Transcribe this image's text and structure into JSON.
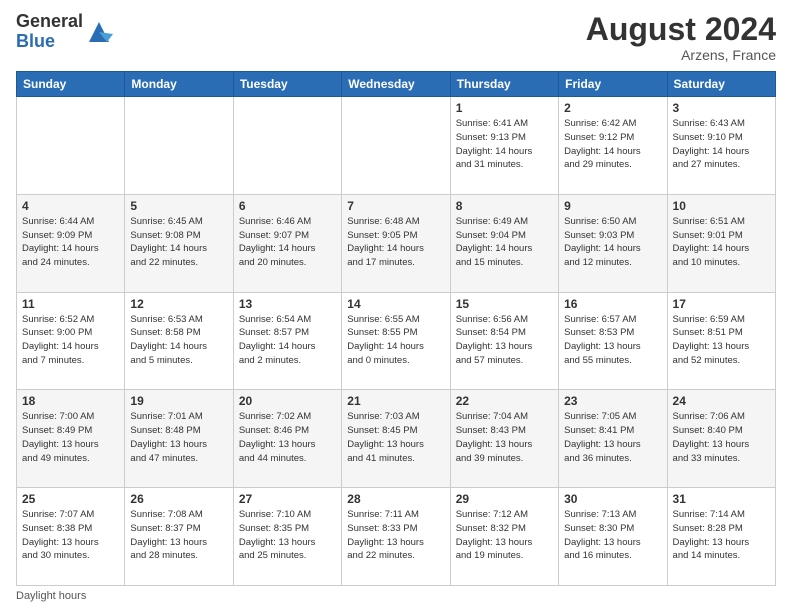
{
  "header": {
    "logo_general": "General",
    "logo_blue": "Blue",
    "month_year": "August 2024",
    "location": "Arzens, France"
  },
  "days_of_week": [
    "Sunday",
    "Monday",
    "Tuesday",
    "Wednesday",
    "Thursday",
    "Friday",
    "Saturday"
  ],
  "footer": {
    "daylight_hours_label": "Daylight hours"
  },
  "weeks": [
    [
      {
        "day": "",
        "info": ""
      },
      {
        "day": "",
        "info": ""
      },
      {
        "day": "",
        "info": ""
      },
      {
        "day": "",
        "info": ""
      },
      {
        "day": "1",
        "info": "Sunrise: 6:41 AM\nSunset: 9:13 PM\nDaylight: 14 hours\nand 31 minutes."
      },
      {
        "day": "2",
        "info": "Sunrise: 6:42 AM\nSunset: 9:12 PM\nDaylight: 14 hours\nand 29 minutes."
      },
      {
        "day": "3",
        "info": "Sunrise: 6:43 AM\nSunset: 9:10 PM\nDaylight: 14 hours\nand 27 minutes."
      }
    ],
    [
      {
        "day": "4",
        "info": "Sunrise: 6:44 AM\nSunset: 9:09 PM\nDaylight: 14 hours\nand 24 minutes."
      },
      {
        "day": "5",
        "info": "Sunrise: 6:45 AM\nSunset: 9:08 PM\nDaylight: 14 hours\nand 22 minutes."
      },
      {
        "day": "6",
        "info": "Sunrise: 6:46 AM\nSunset: 9:07 PM\nDaylight: 14 hours\nand 20 minutes."
      },
      {
        "day": "7",
        "info": "Sunrise: 6:48 AM\nSunset: 9:05 PM\nDaylight: 14 hours\nand 17 minutes."
      },
      {
        "day": "8",
        "info": "Sunrise: 6:49 AM\nSunset: 9:04 PM\nDaylight: 14 hours\nand 15 minutes."
      },
      {
        "day": "9",
        "info": "Sunrise: 6:50 AM\nSunset: 9:03 PM\nDaylight: 14 hours\nand 12 minutes."
      },
      {
        "day": "10",
        "info": "Sunrise: 6:51 AM\nSunset: 9:01 PM\nDaylight: 14 hours\nand 10 minutes."
      }
    ],
    [
      {
        "day": "11",
        "info": "Sunrise: 6:52 AM\nSunset: 9:00 PM\nDaylight: 14 hours\nand 7 minutes."
      },
      {
        "day": "12",
        "info": "Sunrise: 6:53 AM\nSunset: 8:58 PM\nDaylight: 14 hours\nand 5 minutes."
      },
      {
        "day": "13",
        "info": "Sunrise: 6:54 AM\nSunset: 8:57 PM\nDaylight: 14 hours\nand 2 minutes."
      },
      {
        "day": "14",
        "info": "Sunrise: 6:55 AM\nSunset: 8:55 PM\nDaylight: 14 hours\nand 0 minutes."
      },
      {
        "day": "15",
        "info": "Sunrise: 6:56 AM\nSunset: 8:54 PM\nDaylight: 13 hours\nand 57 minutes."
      },
      {
        "day": "16",
        "info": "Sunrise: 6:57 AM\nSunset: 8:53 PM\nDaylight: 13 hours\nand 55 minutes."
      },
      {
        "day": "17",
        "info": "Sunrise: 6:59 AM\nSunset: 8:51 PM\nDaylight: 13 hours\nand 52 minutes."
      }
    ],
    [
      {
        "day": "18",
        "info": "Sunrise: 7:00 AM\nSunset: 8:49 PM\nDaylight: 13 hours\nand 49 minutes."
      },
      {
        "day": "19",
        "info": "Sunrise: 7:01 AM\nSunset: 8:48 PM\nDaylight: 13 hours\nand 47 minutes."
      },
      {
        "day": "20",
        "info": "Sunrise: 7:02 AM\nSunset: 8:46 PM\nDaylight: 13 hours\nand 44 minutes."
      },
      {
        "day": "21",
        "info": "Sunrise: 7:03 AM\nSunset: 8:45 PM\nDaylight: 13 hours\nand 41 minutes."
      },
      {
        "day": "22",
        "info": "Sunrise: 7:04 AM\nSunset: 8:43 PM\nDaylight: 13 hours\nand 39 minutes."
      },
      {
        "day": "23",
        "info": "Sunrise: 7:05 AM\nSunset: 8:41 PM\nDaylight: 13 hours\nand 36 minutes."
      },
      {
        "day": "24",
        "info": "Sunrise: 7:06 AM\nSunset: 8:40 PM\nDaylight: 13 hours\nand 33 minutes."
      }
    ],
    [
      {
        "day": "25",
        "info": "Sunrise: 7:07 AM\nSunset: 8:38 PM\nDaylight: 13 hours\nand 30 minutes."
      },
      {
        "day": "26",
        "info": "Sunrise: 7:08 AM\nSunset: 8:37 PM\nDaylight: 13 hours\nand 28 minutes."
      },
      {
        "day": "27",
        "info": "Sunrise: 7:10 AM\nSunset: 8:35 PM\nDaylight: 13 hours\nand 25 minutes."
      },
      {
        "day": "28",
        "info": "Sunrise: 7:11 AM\nSunset: 8:33 PM\nDaylight: 13 hours\nand 22 minutes."
      },
      {
        "day": "29",
        "info": "Sunrise: 7:12 AM\nSunset: 8:32 PM\nDaylight: 13 hours\nand 19 minutes."
      },
      {
        "day": "30",
        "info": "Sunrise: 7:13 AM\nSunset: 8:30 PM\nDaylight: 13 hours\nand 16 minutes."
      },
      {
        "day": "31",
        "info": "Sunrise: 7:14 AM\nSunset: 8:28 PM\nDaylight: 13 hours\nand 14 minutes."
      }
    ]
  ]
}
